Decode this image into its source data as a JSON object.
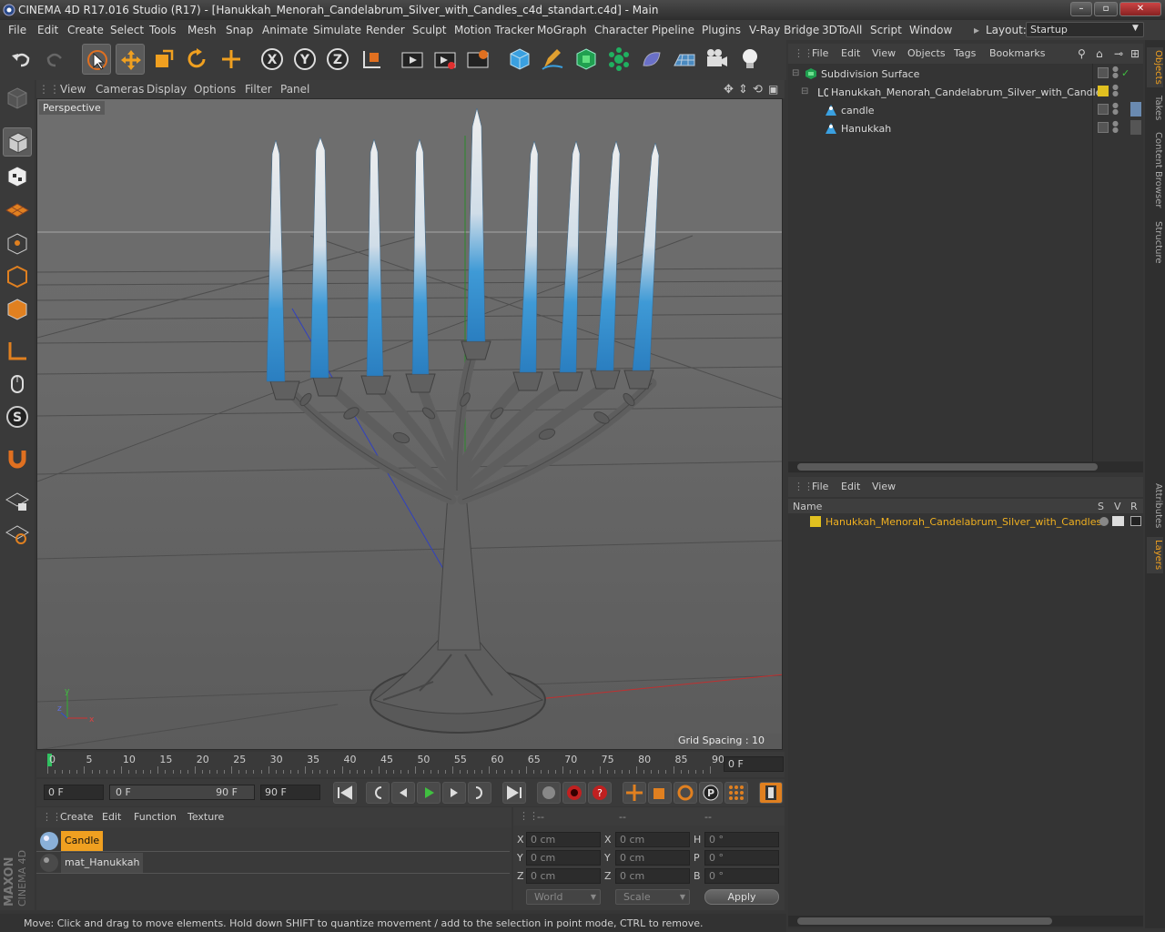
{
  "window": {
    "title": "CINEMA 4D R17.016 Studio (R17) - [Hanukkah_Menorah_Candelabrum_Silver_with_Candles_c4d_standart.c4d] - Main"
  },
  "menu": {
    "items": [
      "File",
      "Edit",
      "Create",
      "Select",
      "Tools",
      "Mesh",
      "Snap",
      "Animate",
      "Simulate",
      "Render",
      "Sculpt",
      "Motion Tracker",
      "MoGraph",
      "Character",
      "Pipeline",
      "Plugins",
      "V-Ray Bridge",
      "3DToAll",
      "Script",
      "Window"
    ],
    "layout_label": "Layout:",
    "layout_value": "Startup"
  },
  "toolbar": {
    "icons": [
      "undo-icon",
      "redo-icon",
      "live-selection-icon",
      "move-icon",
      "scale-icon",
      "rotate-icon",
      "last-tool-icon",
      "x-axis-icon",
      "y-axis-icon",
      "z-axis-icon",
      "coordinate-system-icon",
      "render-view-icon",
      "render-to-picture-viewer-icon",
      "render-settings-icon",
      "cube-icon",
      "pen-icon",
      "subdivision-surface-icon",
      "cloner-icon",
      "deformer-icon",
      "floor-icon",
      "camera-icon",
      "light-icon"
    ]
  },
  "viewport": {
    "menu": [
      "View",
      "Cameras",
      "Display",
      "Options",
      "Filter",
      "Panel"
    ],
    "label": "Perspective",
    "grid_spacing": "Grid Spacing : 10 cm",
    "colors": {
      "candle_blue": "#2f8fd0",
      "candle_white": "#eaeaea",
      "menorah": "#5f5f5f"
    }
  },
  "timeline": {
    "ticks": [
      "0",
      "5",
      "10",
      "15",
      "20",
      "25",
      "30",
      "35",
      "40",
      "45",
      "50",
      "55",
      "60",
      "65",
      "70",
      "75",
      "80",
      "85",
      "90"
    ],
    "current_frame": "0 F",
    "end_frame": "90 F",
    "start_field": "0 F",
    "range_start": "0 F",
    "range_end": "90 F",
    "max_field": "90 F"
  },
  "materials": {
    "menu": [
      "Create",
      "Edit",
      "Function",
      "Texture"
    ],
    "items": [
      {
        "name": "Candle",
        "selected": true
      },
      {
        "name": "mat_Hanukkah",
        "selected": false
      }
    ]
  },
  "coordinates": {
    "headers": [
      "--",
      "--",
      "--"
    ],
    "rows": [
      {
        "a": "X",
        "av": "0 cm",
        "b": "X",
        "bv": "0 cm",
        "c": "H",
        "cv": "0 °"
      },
      {
        "a": "Y",
        "av": "0 cm",
        "b": "Y",
        "bv": "0 cm",
        "c": "P",
        "cv": "0 °"
      },
      {
        "a": "Z",
        "av": "0 cm",
        "b": "Z",
        "bv": "0 cm",
        "c": "B",
        "cv": "0 °"
      }
    ],
    "world": "World",
    "scale": "Scale",
    "apply": "Apply"
  },
  "objects": {
    "menu": [
      "File",
      "Edit",
      "View",
      "Objects",
      "Tags",
      "Bookmarks"
    ],
    "tree": [
      {
        "name": "Subdivision Surface",
        "indent": 0
      },
      {
        "name": "Hanukkah_Menorah_Candelabrum_Silver_with_Candles",
        "indent": 1
      },
      {
        "name": "candle",
        "indent": 2
      },
      {
        "name": "Hanukkah",
        "indent": 2
      }
    ]
  },
  "layers": {
    "menu": [
      "File",
      "Edit",
      "View"
    ],
    "headers": {
      "name": "Name",
      "s": "S",
      "v": "V",
      "r": "R"
    },
    "items": [
      {
        "name": "Hanukkah_Menorah_Candelabrum_Silver_with_Candles",
        "color": "#e0c020"
      }
    ]
  },
  "sidetabs": [
    "Objects",
    "Takes",
    "Content Browser",
    "Structure",
    "Attributes",
    "Layers"
  ],
  "logo": {
    "brand": "MAXON",
    "product": "CINEMA 4D"
  },
  "status": "Move: Click and drag to move elements. Hold down SHIFT to quantize movement / add to the selection in point mode, CTRL to remove."
}
